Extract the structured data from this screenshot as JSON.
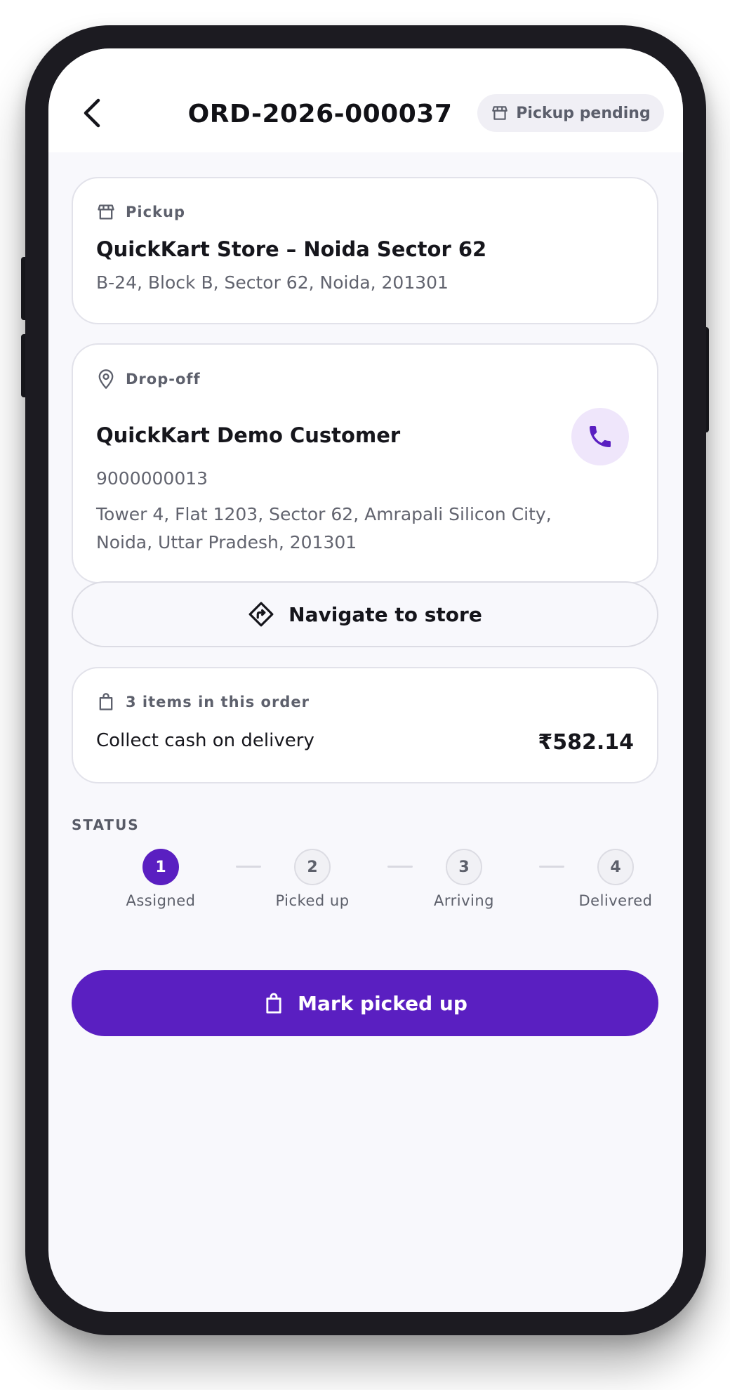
{
  "header": {
    "order_id": "ORD-2026-000037",
    "status_badge": "Pickup pending"
  },
  "pickup": {
    "label": "Pickup",
    "store_name": "QuickKart Store – Noida Sector 62",
    "address": "B-24, Block B, Sector 62, Noida, 201301"
  },
  "dropoff": {
    "label": "Drop-off",
    "customer_name": "QuickKart Demo Customer",
    "phone": "9000000013",
    "address_line1": "Tower 4, Flat 1203, Sector 62, Amrapali Silicon City,",
    "address_line2": "Noida, Uttar Pradesh, 201301"
  },
  "navigate": {
    "label": "Navigate to store"
  },
  "order_summary": {
    "items_label": "3 items in this order",
    "payment_label": "Collect cash on delivery",
    "amount": "₹582.14"
  },
  "status": {
    "heading": "STATUS",
    "steps": [
      {
        "number": "1",
        "label": "Assigned",
        "state": "active"
      },
      {
        "number": "2",
        "label": "Picked up",
        "state": "todo"
      },
      {
        "number": "3",
        "label": "Arriving",
        "state": "todo"
      },
      {
        "number": "4",
        "label": "Delivered",
        "state": "todo"
      }
    ]
  },
  "primary_action": {
    "label": "Mark picked up"
  },
  "colors": {
    "accent": "#5a1fc1",
    "accent_light": "#efe6fb",
    "background": "#f8f8fc",
    "text_primary": "#16161c",
    "text_secondary": "#62646f"
  },
  "icons": {
    "back": "chevron-left-icon",
    "store": "store-icon",
    "location": "map-pin-icon",
    "phone": "phone-icon",
    "navigate": "directions-icon",
    "bag": "shopping-bag-icon"
  }
}
